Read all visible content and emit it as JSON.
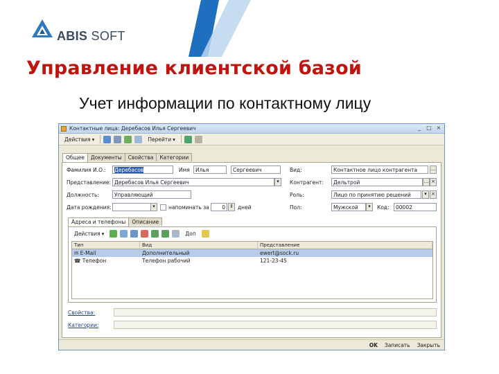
{
  "slide": {
    "logo_strong": "ABIS",
    "logo_light": " SOFT",
    "title": "Управление клиентской базой",
    "subtitle": "Учет информации по контактному лицу"
  },
  "colors": {
    "title": "#c0140f",
    "stripe_dark": "#1f6fc0",
    "stripe_light": "#bcd6ee",
    "selection": "#2f5ea8"
  },
  "window": {
    "title": "Контактные лица: Деребасов Илья Сергеевич",
    "controls": [
      "_",
      "□",
      "×"
    ]
  },
  "toolbar": {
    "actions_label": "Действия",
    "goto_label": "Перейти"
  },
  "tabs": [
    "Общее",
    "Документы",
    "Свойства",
    "Категории"
  ],
  "form": {
    "surname_label": "Фамилия И.О.:",
    "surname_value": "Деребасов",
    "name_label": "Имя",
    "name_value": "Илья",
    "patronymic_value": "Сергеевич",
    "representation_label": "Представление:",
    "representation_value": "Деребасов Илья Сергеевич",
    "position_label": "Должность:",
    "position_value": "Управляющий",
    "birthdate_label": "Дата рождения:",
    "remind_label": "напоминать за",
    "remind_value": "0",
    "days_label": "дней",
    "type_label": "Вид:",
    "type_value": "Контактное лицо контрагента",
    "contractor_label": "Контрагент:",
    "contractor_value": "Дельтрой",
    "role_label": "Роль:",
    "role_value": "Лицо по принятию решений",
    "sex_label": "Пол:",
    "sex_value": "Мужской",
    "code_label": "Код:",
    "code_value": "00002"
  },
  "inner_tabs": [
    "Адреса и телефоны",
    "Описание"
  ],
  "inner_toolbar": {
    "actions_label": "Действия",
    "doc_label": "Доп"
  },
  "contacts": {
    "columns": [
      "Тип",
      "Вид",
      "Представление"
    ],
    "rows": [
      {
        "type": "E-Mail",
        "kind": "Дополнительный",
        "value": "ewert@sock.ru"
      },
      {
        "type": "Телефон",
        "kind": "Телефон рабочий",
        "value": "121-23-45"
      }
    ]
  },
  "links": {
    "properties": "Свойства:",
    "categories": "Категории:"
  },
  "bottom": {
    "ok": "OK",
    "save": "Записать",
    "close": "Закрыть"
  }
}
